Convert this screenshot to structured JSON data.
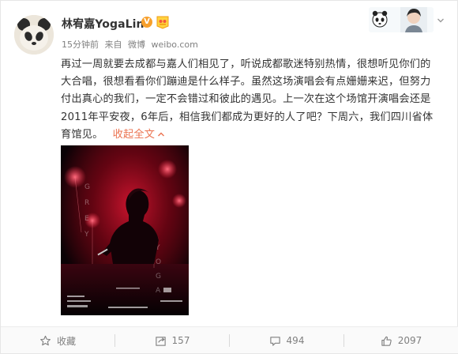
{
  "user": {
    "name": "林宥嘉YogaLin",
    "verified_badge": "V"
  },
  "meta": {
    "time": "15分钟前",
    "source_prefix": "来自",
    "source_app": "微博",
    "source_site": "weibo.com"
  },
  "post": {
    "text": "再过一周就要去成都与嘉人们相见了，听说成都歌迷特别热情，很想听见你们的大合唱，很想看看你们蹦迪是什么样子。虽然这场演唱会有点姗姗来迟，但努力付出真心的我们，一定不会错过和彼此的遇见。上一次在这个场馆开演唱会还是2011年平安夜，6年后，相信我们都成为更好的人了吧？下周六，我们四川省体育馆见。",
    "collapse_label": "收起全文"
  },
  "actions": {
    "favorite_label": "收藏",
    "repost_count": "157",
    "comment_count": "494",
    "like_count": "2097"
  },
  "colors": {
    "accent": "#eb7350",
    "verified": "#f7a02d",
    "poster_red": "#c8102e"
  },
  "icons": {
    "favorite": "star-icon",
    "repost": "repost-icon",
    "comment": "comment-icon",
    "like": "thumbs-up-icon"
  }
}
